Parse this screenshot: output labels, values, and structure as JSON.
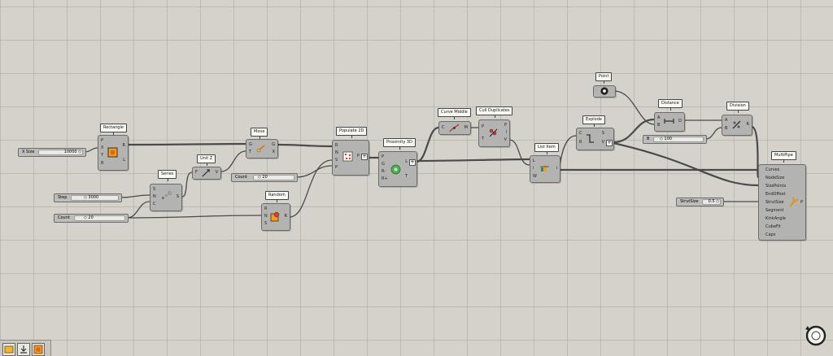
{
  "components": {
    "rectangle": {
      "label": "Rectangle",
      "inputs": [
        "P",
        "X",
        "Y",
        "R"
      ],
      "outputs": [
        "R",
        "L"
      ]
    },
    "series": {
      "label": "Series",
      "inputs": [
        "S",
        "N",
        "C"
      ],
      "outputs": [
        "S"
      ]
    },
    "unit_z": {
      "label": "Unit Z",
      "inputs": [
        "F"
      ],
      "outputs": [
        "V"
      ]
    },
    "move": {
      "label": "Move",
      "inputs": [
        "G",
        "T"
      ],
      "outputs": [
        "G",
        "X"
      ]
    },
    "random": {
      "label": "Random",
      "inputs": [
        "R",
        "N",
        "S"
      ],
      "outputs": [
        "R"
      ]
    },
    "populate_2d": {
      "label": "Populate 2D",
      "inputs": [
        "R",
        "N",
        "S",
        "P"
      ],
      "outputs": [
        "P"
      ]
    },
    "proximity_3d": {
      "label": "Proximity 3D",
      "inputs": [
        "P",
        "G",
        "R-",
        "R+"
      ],
      "outputs": [
        "L",
        "T"
      ]
    },
    "curve_middle": {
      "label": "Curve Middle",
      "inputs": [
        "C"
      ],
      "outputs": [
        "M"
      ]
    },
    "cull_duplicates": {
      "label": "Cull Duplicates",
      "inputs": [
        "P",
        "T"
      ],
      "outputs": [
        "P",
        "I",
        "V"
      ]
    },
    "list_item": {
      "label": "List Item",
      "inputs": [
        "L",
        "i",
        "W"
      ],
      "outputs": [
        "i"
      ]
    },
    "explode": {
      "label": "Explode",
      "inputs": [
        "C",
        "R"
      ],
      "outputs": [
        "S",
        "V"
      ]
    },
    "point": {
      "label": "Point"
    },
    "distance": {
      "label": "Distance",
      "inputs": [
        "A",
        "B"
      ],
      "outputs": [
        "D"
      ]
    },
    "division": {
      "label": "Division",
      "inputs": [
        "A",
        "B"
      ],
      "outputs": [
        "R"
      ]
    },
    "multipipe": {
      "label": "MultiPipe",
      "inputs": [
        "Curves",
        "NodeSize",
        "SizePoints",
        "EndOffset",
        "StrutSize",
        "Segment",
        "KinkAngle",
        "CubeFit",
        "Caps"
      ],
      "outputs": [
        "P"
      ]
    }
  },
  "sliders": {
    "xsize": {
      "label": "X Size",
      "value": "10000 ◇"
    },
    "step": {
      "label": "Step",
      "value": "◇ 3000"
    },
    "count_a": {
      "label": "Count",
      "value": "◇ 20"
    },
    "count_b": {
      "label": "Count",
      "value": "◇ 20"
    },
    "b_val": {
      "label": "B",
      "value": "◇ 100"
    },
    "strutsize": {
      "label": "StrutSize",
      "value": "0.5 ◇"
    }
  },
  "toolbar": {
    "icons": [
      "bake-icon",
      "save-icon",
      "preview-icon"
    ]
  },
  "colors": {
    "canvas": "#d4d2ca",
    "node": "#b3b3b1",
    "wire": "#4a4a4a",
    "panel": "#f2f2ee"
  }
}
